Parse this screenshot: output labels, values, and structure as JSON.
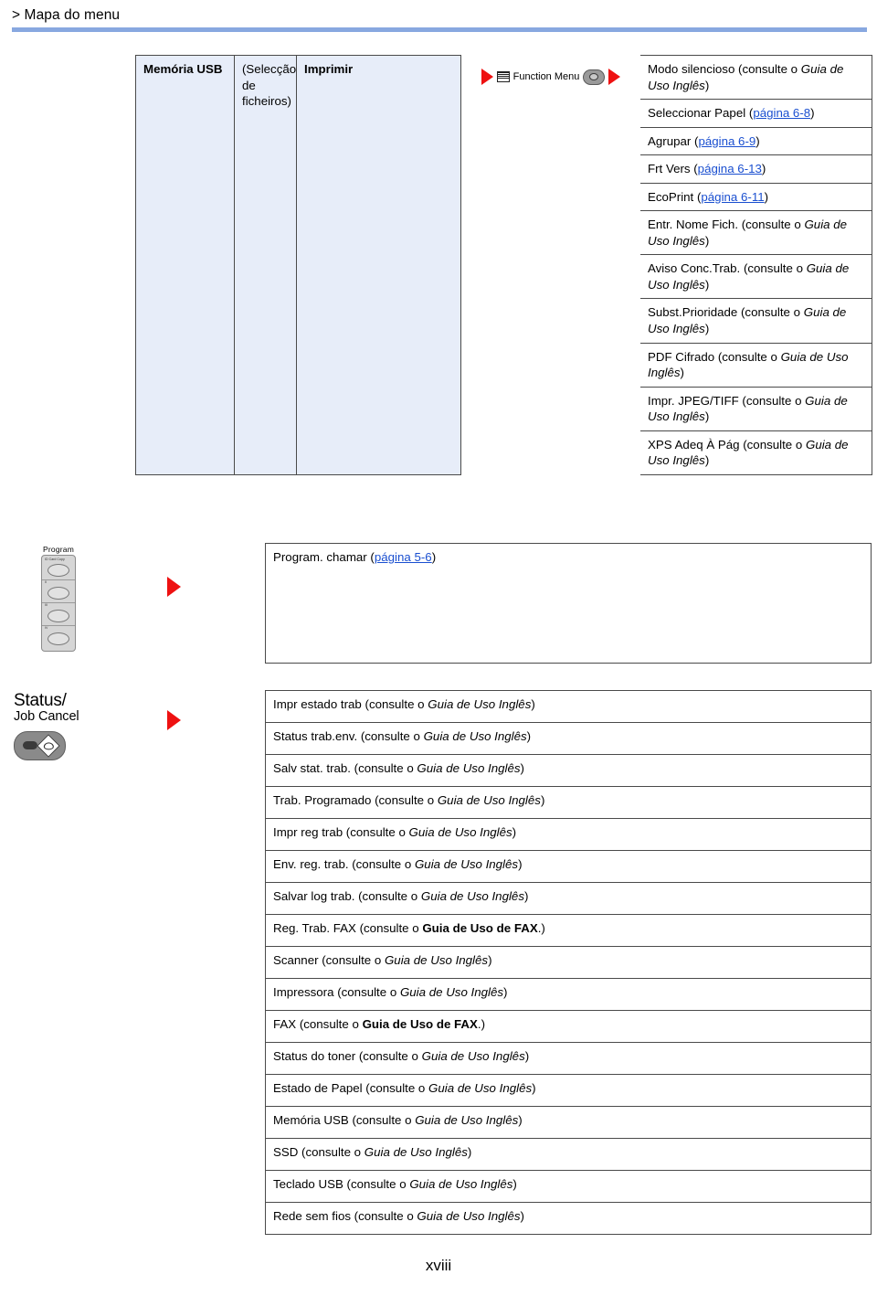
{
  "breadcrumb": "> Mapa do menu",
  "page_number": "xviii",
  "colors": {
    "header_rule": "#88a8e0",
    "shade_cell": "#e7edf9",
    "arrow_red": "#ee1111",
    "link_blue": "#1a4fd0",
    "border": "#4a4a4a"
  },
  "usb_section": {
    "col1": "Memória USB",
    "col2": "(Selecção de ficheiros)",
    "col3": "Imprimir",
    "function_key_label": "Function Menu",
    "items": [
      {
        "pre": "Modo silencioso (consulte o ",
        "ital": "Guia de Uso Inglês",
        "post": ")"
      },
      {
        "pre": "Seleccionar Papel (",
        "link": "página 6-8",
        "post": ")"
      },
      {
        "pre": "Agrupar (",
        "link": "página 6-9",
        "post": ")"
      },
      {
        "pre": "Frt Vers (",
        "link": "página 6-13",
        "post": ")"
      },
      {
        "pre": "EcoPrint (",
        "link": "página 6-11",
        "post": ")"
      },
      {
        "pre": "Entr. Nome Fich. (consulte o ",
        "ital": "Guia de Uso Inglês",
        "post": ")"
      },
      {
        "pre": "Aviso Conc.Trab. (consulte o ",
        "ital": "Guia de Uso Inglês",
        "post": ")"
      },
      {
        "pre": "Subst.Prioridade (consulte o ",
        "ital": "Guia de Uso Inglês",
        "post": ")"
      },
      {
        "pre": "PDF Cifrado (consulte o ",
        "ital": "Guia de Uso Inglês",
        "post": ")"
      },
      {
        "pre": "Impr. JPEG/TIFF (consulte o ",
        "ital": "Guia de Uso Inglês",
        "post": ")"
      },
      {
        "pre": "XPS Adeq À Pág (consulte o ",
        "ital": "Guia de Uso Inglês",
        "post": ")"
      }
    ]
  },
  "program_section": {
    "key_label": "Program",
    "key_captions": [
      "ID Card Copy",
      "II",
      "III",
      "IV"
    ],
    "items": [
      {
        "pre": "Program. chamar (",
        "link": "página 5-6",
        "post": ")"
      }
    ]
  },
  "status_section": {
    "key_label_line1": "Status/",
    "key_label_line2": "Job Cancel",
    "items": [
      {
        "pre": "Impr estado trab (consulte o ",
        "ital": "Guia de Uso Inglês",
        "post": ")"
      },
      {
        "pre": "Status trab.env. (consulte o ",
        "ital": "Guia de Uso Inglês",
        "post": ")"
      },
      {
        "pre": "Salv stat. trab. (consulte o ",
        "ital": "Guia de Uso Inglês",
        "post": ")"
      },
      {
        "pre": "Trab. Programado (consulte o ",
        "ital": "Guia de Uso Inglês",
        "post": ")"
      },
      {
        "pre": "Impr reg trab (consulte o ",
        "ital": "Guia de Uso Inglês",
        "post": ")"
      },
      {
        "pre": "Env. reg. trab. (consulte o ",
        "ital": "Guia de Uso Inglês",
        "post": ")"
      },
      {
        "pre": "Salvar log trab. (consulte o ",
        "ital": "Guia de Uso Inglês",
        "post": ")"
      },
      {
        "pre": "Reg. Trab. FAX (consulte o ",
        "bold": "Guia de Uso de FAX",
        "post": ".)"
      },
      {
        "pre": "Scanner (consulte o ",
        "ital": "Guia de Uso Inglês",
        "post": ")"
      },
      {
        "pre": "Impressora (consulte o ",
        "ital": "Guia de Uso Inglês",
        "post": ")"
      },
      {
        "pre": "FAX (consulte o ",
        "bold": "Guia de Uso de FAX",
        "post": ".)"
      },
      {
        "pre": "Status do toner (consulte o ",
        "ital": "Guia de Uso Inglês",
        "post": ")"
      },
      {
        "pre": "Estado de Papel (consulte o ",
        "ital": "Guia de Uso Inglês",
        "post": ")"
      },
      {
        "pre": "Memória USB (consulte o ",
        "ital": "Guia de Uso Inglês",
        "post": ")"
      },
      {
        "pre": "SSD (consulte o ",
        "ital": "Guia de Uso Inglês",
        "post": ")"
      },
      {
        "pre": "Teclado USB (consulte o ",
        "ital": "Guia de Uso Inglês",
        "post": ")"
      },
      {
        "pre": "Rede sem fios (consulte o ",
        "ital": "Guia de Uso Inglês",
        "post": ")"
      }
    ]
  }
}
